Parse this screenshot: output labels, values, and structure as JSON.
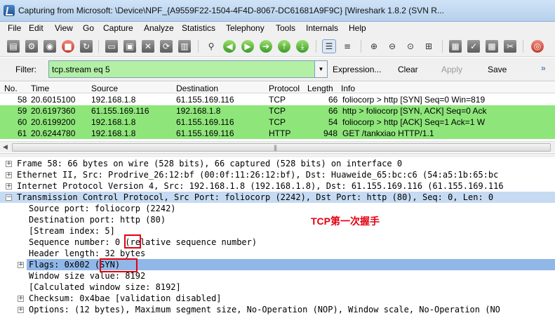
{
  "window": {
    "title": "Capturing from Microsoft: \\Device\\NPF_{A9559F22-1504-4F4D-8067-DC61681A9F9C}   [Wireshark 1.8.2  (SVN R..."
  },
  "menu": [
    "File",
    "Edit",
    "View",
    "Go",
    "Capture",
    "Analyze",
    "Statistics",
    "Telephony",
    "Tools",
    "Internals",
    "Help"
  ],
  "filter": {
    "label": "Filter:",
    "value": "tcp.stream eq 5",
    "buttons": {
      "expression": "Expression...",
      "clear": "Clear",
      "apply": "Apply",
      "save": "Save"
    },
    "more": "»"
  },
  "packet_list": {
    "columns": {
      "no": "No.",
      "time": "Time",
      "source": "Source",
      "destination": "Destination",
      "protocol": "Protocol",
      "length": "Length",
      "info": "Info"
    },
    "rows": [
      {
        "no": "58",
        "time": "20.6015100",
        "source": "192.168.1.8",
        "destination": "61.155.169.116",
        "protocol": "TCP",
        "length": "66",
        "info": "foliocorp > http [SYN] Seq=0 Win=819",
        "bg": "#ffffff"
      },
      {
        "no": "59",
        "time": "20.6197360",
        "source": "61.155.169.116",
        "destination": "192.168.1.8",
        "protocol": "TCP",
        "length": "66",
        "info": "http > foliocorp [SYN, ACK] Seq=0 Ack",
        "bg": "#8ee67a"
      },
      {
        "no": "60",
        "time": "20.6199200",
        "source": "192.168.1.8",
        "destination": "61.155.169.116",
        "protocol": "TCP",
        "length": "54",
        "info": "foliocorp > http [ACK] Seq=1 Ack=1 W",
        "bg": "#8ee67a"
      },
      {
        "no": "61",
        "time": "20.6244780",
        "source": "192.168.1.8",
        "destination": "61.155.169.116",
        "protocol": "HTTP",
        "length": "948",
        "info": "GET /tankxiao HTTP/1.1",
        "bg": "#8ee67a"
      }
    ]
  },
  "details": [
    {
      "text": "Frame 58: 66 bytes on wire (528 bits), 66 captured (528 bits) on interface 0",
      "expander": "+",
      "level": 0
    },
    {
      "text": "Ethernet II, Src: Prodrive_26:12:bf (00:0f:11:26:12:bf), Dst: Huaweide_65:bc:c6 (54:a5:1b:65:bc",
      "expander": "+",
      "level": 0
    },
    {
      "text": "Internet Protocol Version 4, Src: 192.168.1.8 (192.168.1.8), Dst: 61.155.169.116 (61.155.169.116",
      "expander": "+",
      "level": 0
    },
    {
      "text": "Transmission Control Protocol, Src Port: foliocorp (2242), Dst Port: http (80), Seq: 0, Len: 0",
      "expander": "−",
      "level": 0,
      "highlight": "light"
    },
    {
      "text": "Source port: foliocorp (2242)",
      "expander": "",
      "level": 1
    },
    {
      "text": "Destination port: http (80)",
      "expander": "",
      "level": 1
    },
    {
      "text": "[Stream index: 5]",
      "expander": "",
      "level": 1
    },
    {
      "text": "Sequence number: 0    (relative sequence number)",
      "expander": "",
      "level": 1
    },
    {
      "text": "Header length: 32 bytes",
      "expander": "",
      "level": 1
    },
    {
      "text": "Flags: 0x002 (SYN)",
      "expander": "+",
      "level": 1,
      "highlight": "dark"
    },
    {
      "text": "Window size value: 8192",
      "expander": "",
      "level": 1
    },
    {
      "text": "[Calculated window size: 8192]",
      "expander": "",
      "level": 1
    },
    {
      "text": "Checksum: 0x4bae [validation disabled]",
      "expander": "+",
      "level": 1
    },
    {
      "text": "Options: (12 bytes), Maximum segment size, No-Operation (NOP), Window scale, No-Operation (NO",
      "expander": "+",
      "level": 1
    }
  ],
  "annotation": "TCP第一次握手"
}
